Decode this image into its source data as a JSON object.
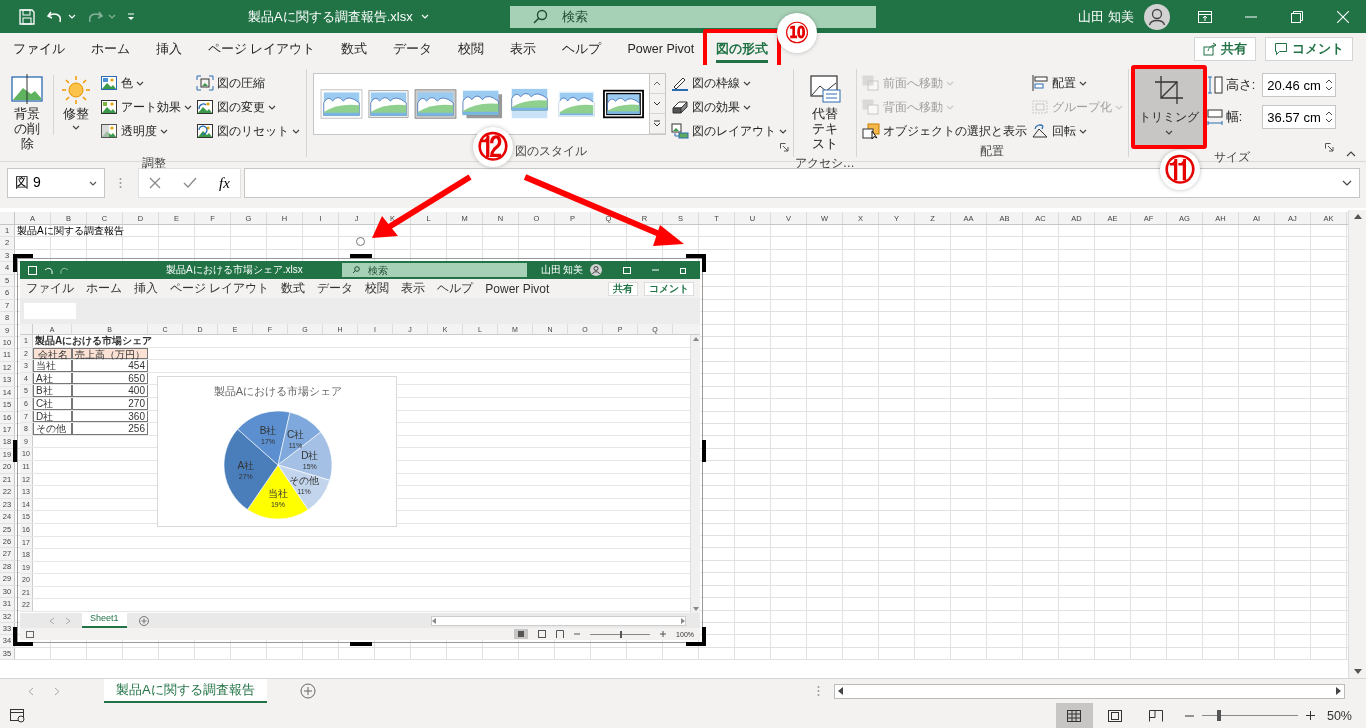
{
  "title_bar": {
    "title": "製品Aに関する調査報告.xlsx",
    "search": {
      "placeholder": "検索"
    },
    "user": "山田 知美"
  },
  "ribbon_tabs": [
    {
      "label": "ファイル",
      "selected": false
    },
    {
      "label": "ホーム",
      "selected": false
    },
    {
      "label": "挿入",
      "selected": false
    },
    {
      "label": "ページ レイアウト",
      "selected": false
    },
    {
      "label": "数式",
      "selected": false
    },
    {
      "label": "データ",
      "selected": false
    },
    {
      "label": "校閲",
      "selected": false
    },
    {
      "label": "表示",
      "selected": false
    },
    {
      "label": "ヘルプ",
      "selected": false
    },
    {
      "label": "Power Pivot",
      "selected": false
    },
    {
      "label": "図の形式",
      "selected": true
    }
  ],
  "share_button": "共有",
  "comment_button": "コメント",
  "adjust_group": {
    "label": "調整",
    "remove_background": "背景の削除",
    "corrections": "修整",
    "buttons": [
      {
        "label": "色",
        "dropdown": true
      },
      {
        "label": "アート効果",
        "dropdown": true
      },
      {
        "label": "透明度",
        "dropdown": true
      },
      {
        "label": "図の圧縮",
        "dropdown": false
      },
      {
        "label": "図の変更",
        "dropdown": true
      },
      {
        "label": "図のリセット",
        "dropdown": true
      }
    ]
  },
  "styles_group": {
    "label": "図のスタイル",
    "styles": [
      {
        "kind": "white-frame"
      },
      {
        "kind": "thin-frame"
      },
      {
        "kind": "gray-frame"
      },
      {
        "kind": "shadow"
      },
      {
        "kind": "reflection"
      },
      {
        "kind": "soft-edge"
      },
      {
        "kind": "black-frame"
      }
    ],
    "buttons": [
      {
        "label": "図の枠線",
        "dropdown": true
      },
      {
        "label": "図の効果",
        "dropdown": true
      },
      {
        "label": "図のレイアウト",
        "dropdown": true
      }
    ]
  },
  "accessibility_group": {
    "label": "アクセシ…",
    "alt_text": "代替テキスト"
  },
  "arrange_group": {
    "label": "配置",
    "buttons": [
      {
        "label": "前面へ移動",
        "disabled": true,
        "dropdown": true
      },
      {
        "label": "背面へ移動",
        "disabled": true,
        "dropdown": true
      },
      {
        "label": "オブジェクトの選択と表示",
        "disabled": false,
        "dropdown": false
      },
      {
        "label": "配置",
        "disabled": false,
        "dropdown": true
      },
      {
        "label": "グループ化",
        "disabled": true,
        "dropdown": true
      },
      {
        "label": "回転",
        "disabled": false,
        "dropdown": true
      }
    ]
  },
  "size_group": {
    "label": "サイズ",
    "crop": {
      "label": "トリミング",
      "pressed": true
    },
    "height": {
      "label": "高さ:",
      "value": "20.46 cm"
    },
    "width": {
      "label": "幅:",
      "value": "36.57 cm"
    }
  },
  "formula_bar": {
    "name_box": "図 9",
    "function_label": "fx"
  },
  "sheet": {
    "columns": [
      "A",
      "B",
      "C",
      "D",
      "E",
      "F",
      "G",
      "H",
      "I",
      "J",
      "K",
      "L",
      "M",
      "N",
      "O",
      "P",
      "Q",
      "R",
      "S",
      "T",
      "U",
      "V",
      "W",
      "X",
      "Y",
      "Z",
      "AA",
      "AB",
      "AC",
      "AD",
      "AE",
      "AF",
      "AG",
      "AH",
      "AI",
      "AJ",
      "AK"
    ],
    "rows": [
      {
        "number": "1",
        "cells": [
          "製品Aに関する調査報告"
        ]
      },
      {
        "number": "2"
      },
      {
        "number": "3"
      },
      {
        "number": "4"
      },
      {
        "number": "5"
      },
      {
        "number": "6"
      },
      {
        "number": "7"
      },
      {
        "number": "8"
      },
      {
        "number": "9"
      },
      {
        "number": "10"
      },
      {
        "number": "11"
      },
      {
        "number": "12"
      },
      {
        "number": "13"
      },
      {
        "number": "14"
      },
      {
        "number": "15"
      },
      {
        "number": "16"
      },
      {
        "number": "17"
      },
      {
        "number": "18"
      },
      {
        "number": "19"
      },
      {
        "number": "20"
      },
      {
        "number": "21"
      },
      {
        "number": "22"
      },
      {
        "number": "23"
      },
      {
        "number": "24"
      },
      {
        "number": "25"
      },
      {
        "number": "26"
      },
      {
        "number": "27"
      },
      {
        "number": "28"
      },
      {
        "number": "29"
      },
      {
        "number": "30"
      },
      {
        "number": "31"
      },
      {
        "number": "32"
      },
      {
        "number": "33"
      },
      {
        "number": "34"
      },
      {
        "number": "35"
      }
    ]
  },
  "picture": {
    "title_bar": {
      "title": "製品Aにおける市場シェア.xlsx",
      "search": {
        "placeholder": "検索"
      },
      "user": "山田 知美"
    },
    "ribbon_tabs": [
      "ファイル",
      "ホーム",
      "挿入",
      "ページ レイアウト",
      "数式",
      "データ",
      "校閲",
      "表示",
      "ヘルプ",
      "Power Pivot"
    ],
    "share_button": "共有",
    "comment_button": "コメント",
    "columns": [
      "A",
      "B",
      "C",
      "D",
      "E",
      "F",
      "G",
      "H",
      "I",
      "J",
      "K",
      "L",
      "M",
      "N",
      "O",
      "P",
      "Q"
    ],
    "rows": [
      {
        "number": "1",
        "kind": "title",
        "cells": [
          "製品Aにおける市場シェア"
        ]
      },
      {
        "number": "2",
        "kind": "header",
        "cells": [
          "会社名",
          "売上高（万円）"
        ]
      },
      {
        "number": "3",
        "kind": "data",
        "cells": [
          "当社",
          "454"
        ]
      },
      {
        "number": "4",
        "kind": "data",
        "cells": [
          "A社",
          "650"
        ]
      },
      {
        "number": "5",
        "kind": "data",
        "cells": [
          "B社",
          "400"
        ]
      },
      {
        "number": "6",
        "kind": "data",
        "cells": [
          "C社",
          "270"
        ]
      },
      {
        "number": "7",
        "kind": "data",
        "cells": [
          "D社",
          "360"
        ]
      },
      {
        "number": "8",
        "kind": "data",
        "cells": [
          "その他",
          "256"
        ]
      },
      {
        "number": "9"
      },
      {
        "number": "10"
      },
      {
        "number": "11"
      },
      {
        "number": "12"
      },
      {
        "number": "13"
      },
      {
        "number": "14"
      },
      {
        "number": "15"
      },
      {
        "number": "16"
      },
      {
        "number": "17"
      },
      {
        "number": "18"
      },
      {
        "number": "19"
      },
      {
        "number": "20"
      },
      {
        "number": "21"
      },
      {
        "number": "22"
      }
    ],
    "chart": {
      "chart_data": {
        "type": "pie",
        "title": "製品Aにおける市場シェア",
        "categories": [
          "当社",
          "A社",
          "B社",
          "C社",
          "D社",
          "その他"
        ],
        "values": [
          19,
          27,
          17,
          11,
          15,
          11
        ],
        "value_labels": [
          "19%",
          "27%",
          "17%",
          "11%",
          "15%",
          "11%"
        ]
      }
    },
    "sheet_tabs": [
      {
        "label": "Sheet1",
        "selected": true
      }
    ],
    "zoom": {
      "level": 0.5,
      "reading": "100%"
    }
  },
  "sheet_tabs": [
    {
      "label": "製品Aに関する調査報告",
      "selected": true
    }
  ],
  "status_bar": {
    "views": [
      {
        "kind": "normal",
        "selected": true
      },
      {
        "kind": "page-layout",
        "selected": false
      },
      {
        "kind": "page-break",
        "selected": false
      }
    ],
    "zoom": {
      "level": 0.18,
      "reading": "50%"
    }
  },
  "annotations": [
    {
      "text": "⑩"
    },
    {
      "text": "⑫"
    },
    {
      "text": "⑪"
    }
  ]
}
